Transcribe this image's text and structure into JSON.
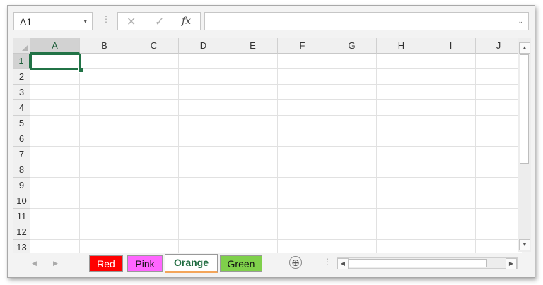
{
  "formula_bar": {
    "name_box": "A1",
    "name_box_caret": "▾",
    "separator": "⋮",
    "cancel_symbol": "✕",
    "enter_symbol": "✓",
    "function_symbol": "fx",
    "formula_value": "",
    "formula_caret": "⌄"
  },
  "grid": {
    "columns": [
      "A",
      "B",
      "C",
      "D",
      "E",
      "F",
      "G",
      "H",
      "I",
      "J"
    ],
    "rows": [
      "1",
      "2",
      "3",
      "4",
      "5",
      "6",
      "7",
      "8",
      "9",
      "10",
      "11",
      "12",
      "13"
    ],
    "selected_cell": "A1"
  },
  "scrollbar": {
    "up": "▲",
    "down": "▼",
    "left": "◀",
    "right": "▶"
  },
  "sheet_nav": {
    "prev": "◀",
    "next": "▶"
  },
  "sheet_tabs": [
    {
      "label": "Red",
      "color": "#ff0000"
    },
    {
      "label": "Pink",
      "color": "#ff66ff"
    },
    {
      "label": "Orange",
      "color": "#f3a55a",
      "active": true
    },
    {
      "label": "Green",
      "color": "#7fd04b"
    }
  ],
  "add_sheet": "⊕",
  "tab_separator": "⋮",
  "colors": {
    "selection": "#217346"
  }
}
